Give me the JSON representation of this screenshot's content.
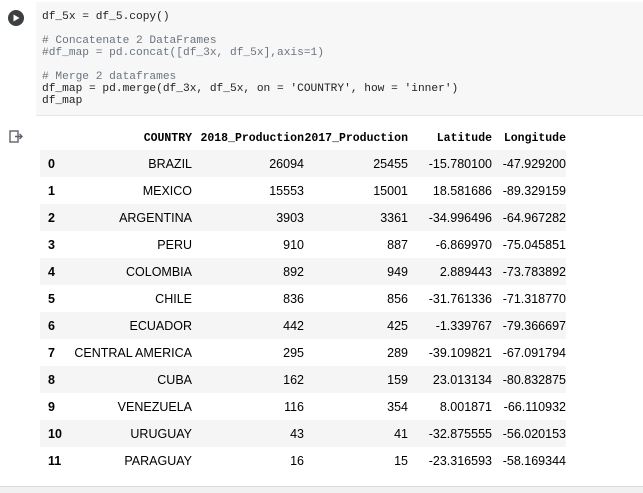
{
  "code_cell": {
    "lines": [
      {
        "text": "df_5x = df_5.copy()",
        "kind": "code"
      },
      {
        "text": "",
        "kind": "blank"
      },
      {
        "text": "# Concatenate 2 DataFrames",
        "kind": "comment"
      },
      {
        "text": "#df_map = pd.concat([df_3x, df_5x],axis=1)",
        "kind": "comment"
      },
      {
        "text": "",
        "kind": "blank"
      },
      {
        "text": "# Merge 2 dataframes",
        "kind": "comment"
      },
      {
        "text": "df_map = pd.merge(df_3x, df_5x, on = 'COUNTRY', how = 'inner')",
        "kind": "code"
      },
      {
        "text": "df_map",
        "kind": "code"
      }
    ]
  },
  "table": {
    "columns": [
      "",
      "COUNTRY",
      "2018_Production",
      "2017_Production",
      "Latitude",
      "Longitude"
    ],
    "rows": [
      [
        "0",
        "BRAZIL",
        "26094",
        "25455",
        "-15.780100",
        "-47.929200"
      ],
      [
        "1",
        "MEXICO",
        "15553",
        "15001",
        "18.581686",
        "-89.329159"
      ],
      [
        "2",
        "ARGENTINA",
        "3903",
        "3361",
        "-34.996496",
        "-64.967282"
      ],
      [
        "3",
        "PERU",
        "910",
        "887",
        "-6.869970",
        "-75.045851"
      ],
      [
        "4",
        "COLOMBIA",
        "892",
        "949",
        "2.889443",
        "-73.783892"
      ],
      [
        "5",
        "CHILE",
        "836",
        "856",
        "-31.761336",
        "-71.318770"
      ],
      [
        "6",
        "ECUADOR",
        "442",
        "425",
        "-1.339767",
        "-79.366697"
      ],
      [
        "7",
        "CENTRAL AMERICA",
        "295",
        "289",
        "-39.109821",
        "-67.091794"
      ],
      [
        "8",
        "CUBA",
        "162",
        "159",
        "23.013134",
        "-80.832875"
      ],
      [
        "9",
        "VENEZUELA",
        "116",
        "354",
        "8.001871",
        "-66.110932"
      ],
      [
        "10",
        "URUGUAY",
        "43",
        "41",
        "-32.875555",
        "-56.020153"
      ],
      [
        "11",
        "PARAGUAY",
        "16",
        "15",
        "-23.316593",
        "-58.169344"
      ]
    ]
  }
}
